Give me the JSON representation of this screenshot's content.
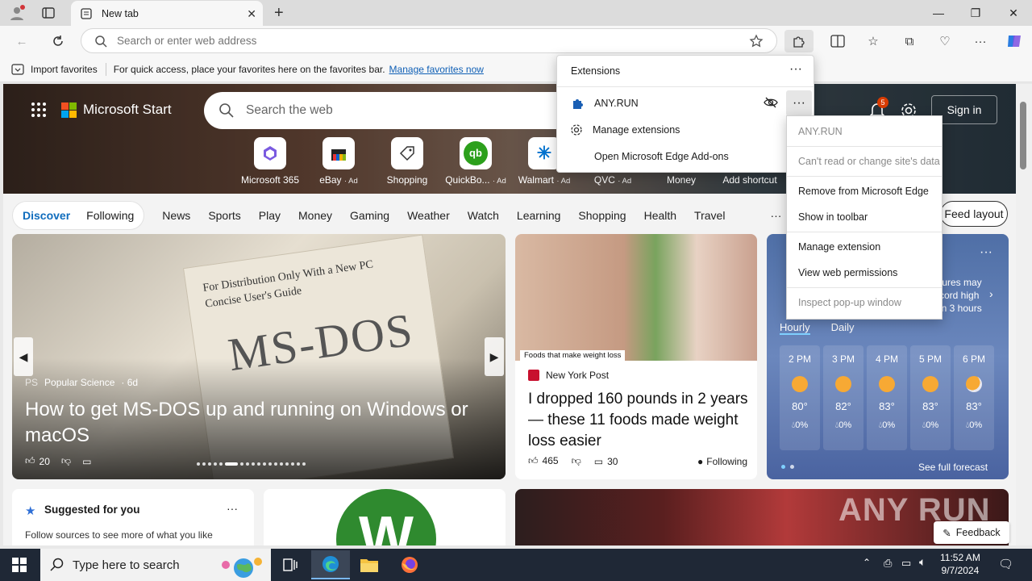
{
  "browser": {
    "tab_title": "New tab",
    "address_placeholder": "Search or enter web address"
  },
  "favbar": {
    "import_label": "Import favorites",
    "hint": "For quick access, place your favorites here on the favorites bar.",
    "manage_link": "Manage favorites now"
  },
  "msstart": {
    "brand": "Microsoft Start",
    "search_placeholder": "Search the web",
    "sign_in": "Sign in",
    "notif_count": "5",
    "quicklinks": [
      {
        "label": "Microsoft 365",
        "ad": ""
      },
      {
        "label": "eBay",
        "ad": "· Ad"
      },
      {
        "label": "Shopping",
        "ad": ""
      },
      {
        "label": "QuickBo...",
        "ad": "· Ad"
      },
      {
        "label": "Walmart",
        "ad": "· Ad"
      },
      {
        "label": "QVC",
        "ad": "· Ad"
      },
      {
        "label": "Money",
        "ad": ""
      },
      {
        "label": "Add shortcut",
        "ad": ""
      }
    ]
  },
  "nav": {
    "discover": "Discover",
    "following": "Following",
    "items": [
      "News",
      "Sports",
      "Play",
      "Money",
      "Gaming",
      "Weather",
      "Watch",
      "Learning",
      "Shopping",
      "Health",
      "Travel"
    ],
    "more": "···",
    "feed_layout": "Feed layout"
  },
  "main_story": {
    "source": "Popular Science",
    "age": "· 6d",
    "source_abbr": "PS",
    "headline": "How to get MS-DOS up and running on Windows or macOS",
    "likes": "20",
    "image_text_1": "For Distribution Only With a New PC",
    "image_text_2": "Concise User's Guide",
    "image_text_3": "MS-DOS"
  },
  "ny_story": {
    "caption": "Foods that make weight loss",
    "source": "New York Post",
    "headline": "I dropped 160 pounds in 2 years — these 11 foods made weight loss easier",
    "likes": "465",
    "comments": "30",
    "following": "Following"
  },
  "weather": {
    "text": "tures may\ncord high\nin 3 hours",
    "tab_hourly": "Hourly",
    "tab_daily": "Daily",
    "hours": [
      {
        "time": "2 PM",
        "temp": "80°",
        "precip": "0%"
      },
      {
        "time": "3 PM",
        "temp": "82°",
        "precip": "0%"
      },
      {
        "time": "4 PM",
        "temp": "83°",
        "precip": "0%"
      },
      {
        "time": "5 PM",
        "temp": "83°",
        "precip": "0%"
      },
      {
        "time": "6 PM",
        "temp": "83°",
        "precip": "0%"
      }
    ],
    "full_forecast": "See full forecast"
  },
  "suggested": {
    "title": "Suggested for you",
    "subtitle": "Follow sources to see more of what you like"
  },
  "feedback": "Feedback",
  "extensions": {
    "title": "Extensions",
    "ext_name": "ANY.RUN",
    "manage": "Manage extensions",
    "open_addons": "Open Microsoft Edge Add-ons"
  },
  "context_menu": {
    "header": "ANY.RUN",
    "perm": "Can't read or change site's data",
    "remove": "Remove from Microsoft Edge",
    "show_toolbar": "Show in toolbar",
    "manage": "Manage extension",
    "permissions": "View web permissions",
    "inspect": "Inspect pop-up window"
  },
  "taskbar": {
    "search": "Type here to search",
    "time": "11:52 AM",
    "date": "9/7/2024"
  },
  "watermark": "ANY RUN",
  "colors": {
    "accent": "#0f6cbd",
    "taskbar": "#1f2836"
  }
}
